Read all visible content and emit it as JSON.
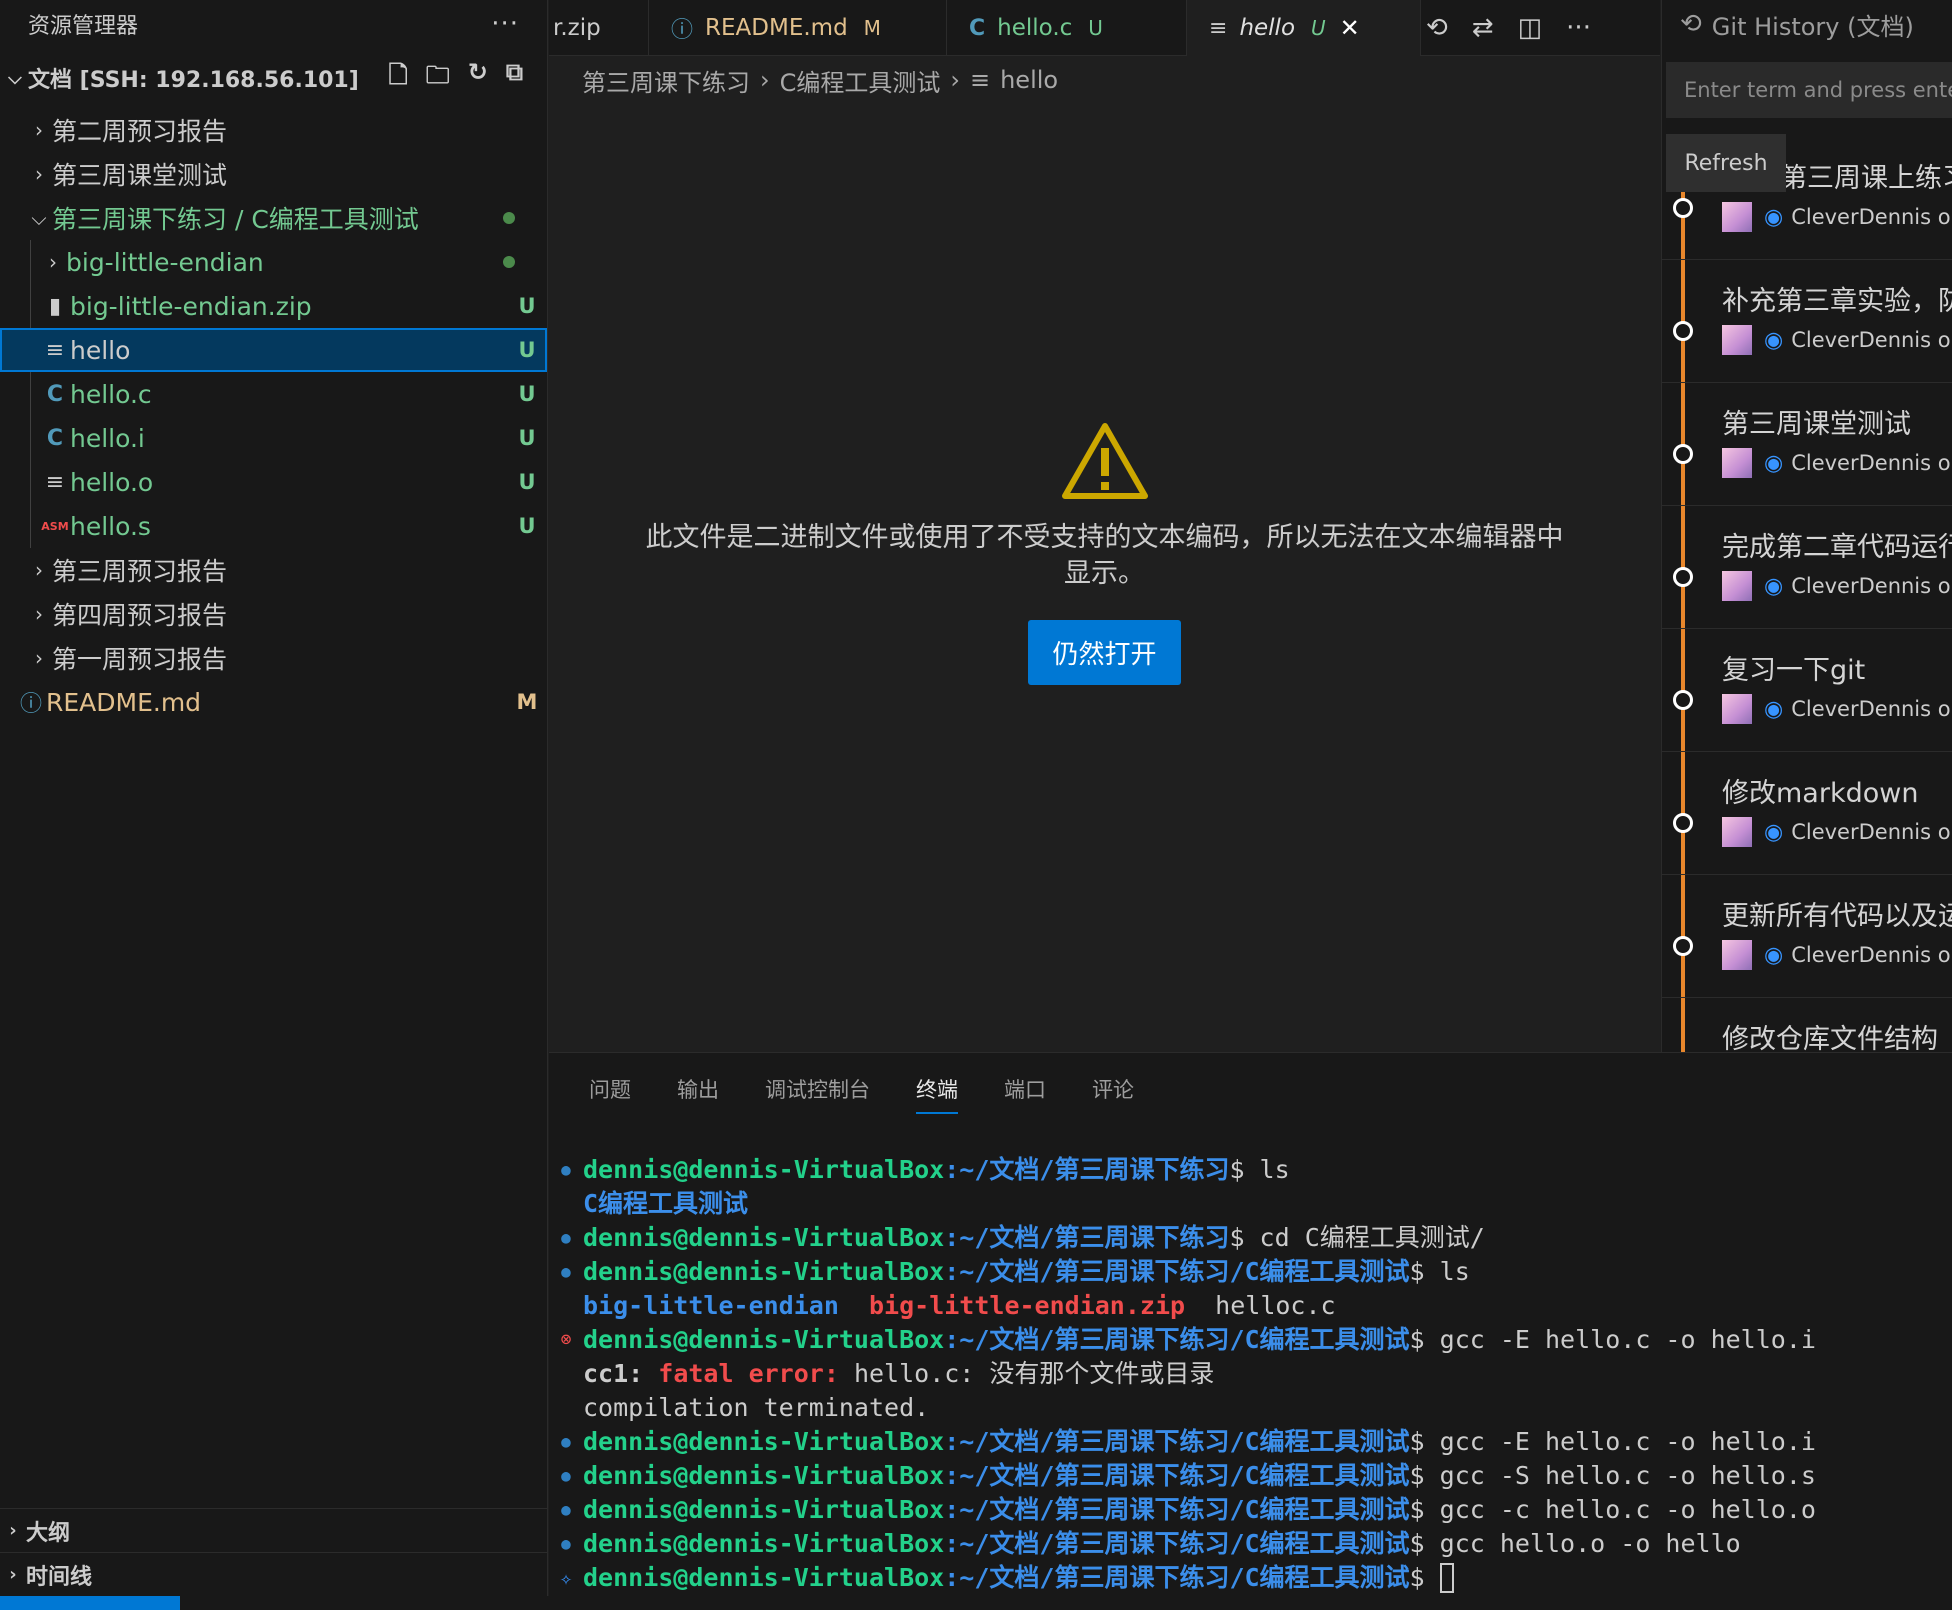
{
  "sidebar": {
    "title": "资源管理器",
    "more": "···",
    "root_label": "文档 [SSH: 192.168.56.101]",
    "tree": [
      {
        "name": "第二周预习报告",
        "badge": ""
      },
      {
        "name": "第三周课堂测试",
        "badge": ""
      },
      {
        "name": "第三周课下练习 / C编程工具测试",
        "badge": ""
      },
      {
        "name": "big-little-endian",
        "badge": ""
      },
      {
        "name": "big-little-endian.zip",
        "badge": "U"
      },
      {
        "name": "hello",
        "badge": "U"
      },
      {
        "name": "hello.c",
        "badge": "U"
      },
      {
        "name": "hello.i",
        "badge": "U"
      },
      {
        "name": "hello.o",
        "badge": "U"
      },
      {
        "name": "hello.s",
        "badge": "U"
      },
      {
        "name": "第三周预习报告",
        "badge": ""
      },
      {
        "name": "第四周预习报告",
        "badge": ""
      },
      {
        "name": "第一周预习报告",
        "badge": ""
      },
      {
        "name": "README.md",
        "badge": "M"
      }
    ],
    "icons": {
      "c_file": "C",
      "asm_file": "ASM",
      "info": "ⓘ"
    },
    "outline": "大纲",
    "timeline": "时间线"
  },
  "tabs": [
    {
      "name": "r.zip",
      "badge": ""
    },
    {
      "name": "README.md",
      "badge": "M"
    },
    {
      "name": "hello.c",
      "badge": "U"
    },
    {
      "name": "hello",
      "badge": "U"
    }
  ],
  "breadcrumb": [
    "第三周课下练习",
    "C编程工具测试",
    "hello"
  ],
  "editor": {
    "message": "此文件是二进制文件或使用了不受支持的文本编码，所以无法在文本编辑器中显示。",
    "open_button": "仍然打开"
  },
  "git_history": {
    "title": "Git History (文档)",
    "search_placeholder": "Enter term and press enter",
    "refresh": "Refresh",
    "author_suffix": "CleverDennis on",
    "commits": [
      {
        "message": "第三周课上练习"
      },
      {
        "message": "补充第三章实验，防"
      },
      {
        "message": "第三周课堂测试"
      },
      {
        "message": "完成第二章代码运行"
      },
      {
        "message": "复习一下git"
      },
      {
        "message": "修改markdown"
      },
      {
        "message": "更新所有代码以及运"
      },
      {
        "message": "修改仓库文件结构"
      }
    ]
  },
  "panel": {
    "tabs": [
      "问题",
      "输出",
      "调试控制台",
      "终端",
      "端口",
      "评论"
    ],
    "active_tab": "终端"
  },
  "terminal": {
    "user": "dennis@dennis-VirtualBox",
    "path_base": ":~/文档/第三周课下练习",
    "path_sub": ":~/文档/第三周课下练习/C编程工具测试",
    "cmd1": "$ ls",
    "out1": "C编程工具测试",
    "cmd2": "$ cd C编程工具测试/",
    "cmd3": "$ ls",
    "ls_dir": "big-little-endian",
    "ls_zip": "big-little-endian.zip",
    "ls_file": "helloc.c",
    "cmd4": "$ gcc -E hello.c -o hello.i",
    "err_prefix": "cc1: ",
    "err_fatal": "fatal error:",
    "err_msg": " hello.c: 没有那个文件或目录",
    "err_term": "compilation terminated.",
    "cmd5": "$ gcc -E hello.c -o hello.i",
    "cmd6": "$ gcc -S hello.c -o hello.s",
    "cmd7": "$ gcc -c hello.c -o hello.o",
    "cmd8": "$ gcc hello.o -o hello",
    "cmd9": "$ "
  },
  "colors": {
    "accent": "#0078d4",
    "git_line": "#e8872c",
    "untracked": "#73c991",
    "modified": "#e2c08d",
    "warning": "#cca700"
  }
}
